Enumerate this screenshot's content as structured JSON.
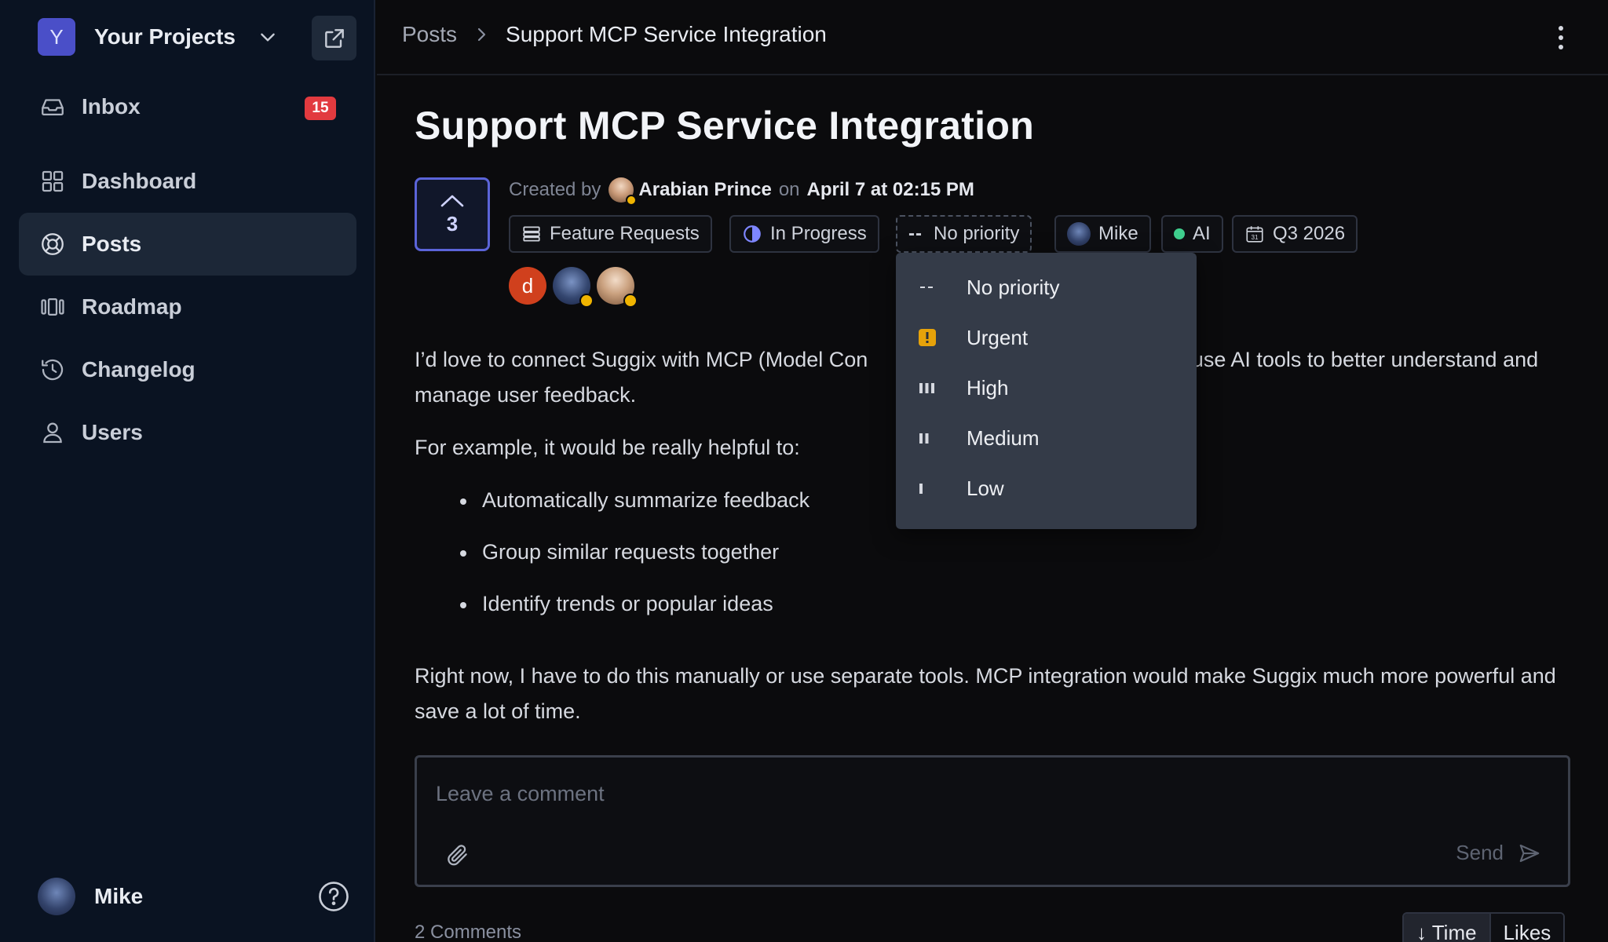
{
  "sidebar": {
    "project": {
      "initial": "Y",
      "name": "Your Projects"
    },
    "nav": [
      {
        "label": "Inbox",
        "badge": "15"
      },
      {
        "label": "Dashboard"
      },
      {
        "label": "Posts",
        "active": true
      },
      {
        "label": "Roadmap"
      },
      {
        "label": "Changelog"
      },
      {
        "label": "Users"
      }
    ],
    "user": {
      "name": "Mike"
    }
  },
  "header": {
    "breadcrumb_root": "Posts",
    "breadcrumb_current": "Support MCP Service Integration"
  },
  "post": {
    "title": "Support MCP Service Integration",
    "votes": "3",
    "created_by_label": "Created by",
    "author": "Arabian Prince",
    "on_label": "on",
    "date": "April 7 at 02:15 PM",
    "chips": {
      "board": "Feature Requests",
      "status": "In Progress",
      "priority_dash": "--",
      "priority": "No priority",
      "assignee": "Mike",
      "tag": "AI",
      "eta": "Q3 2026"
    },
    "voters": {
      "first_initial": "d"
    },
    "body": {
      "p1": "I’d love to connect Suggix with MCP (Model Con",
      "p1_tail": "n use AI tools to better understand and manage user feedback.",
      "p2": "For example, it would be really helpful to:",
      "bullets": [
        "Automatically summarize feedback",
        "Group similar requests together",
        "Identify trends or popular ideas"
      ],
      "p3": "Right now, I have to do this manually or use separate tools. MCP integration would make Suggix much more powerful and save a lot of time."
    }
  },
  "comment": {
    "placeholder": "Leave a comment",
    "send_label": "Send",
    "count_label": "2 Comments",
    "sort": {
      "time": "↓ Time",
      "likes": "Likes"
    }
  },
  "priority_menu": {
    "items": [
      {
        "label": "No priority",
        "icon": "dash-icon"
      },
      {
        "label": "Urgent",
        "icon": "urgent-icon",
        "color": "#e6a20a"
      },
      {
        "label": "High",
        "icon": "bars-high-icon"
      },
      {
        "label": "Medium",
        "icon": "bars-medium-icon"
      },
      {
        "label": "Low",
        "icon": "bars-low-icon"
      }
    ]
  },
  "colors": {
    "accent": "#5b64d8",
    "badge": "#e23a3f",
    "tag_dot": "#3fcf8e",
    "sidebar_bg": "#0a1322"
  }
}
